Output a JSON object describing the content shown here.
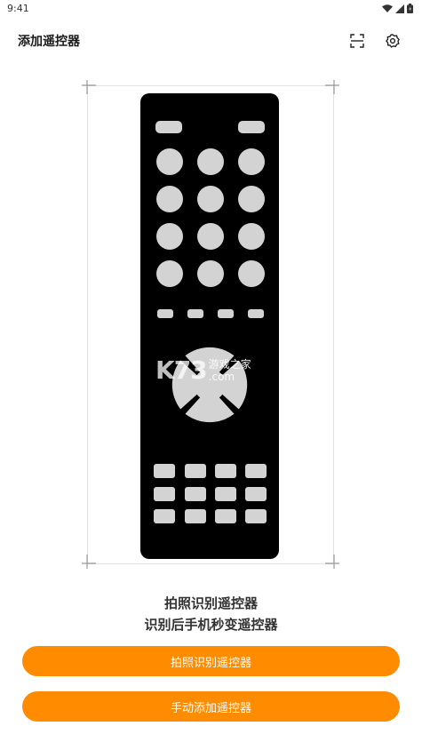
{
  "status_bar": {
    "time": "9:41",
    "icons": [
      "wifi-icon",
      "signal-icon",
      "battery-icon"
    ]
  },
  "appbar": {
    "title": "添加遥控器",
    "icons": [
      "scan-icon",
      "gear-icon"
    ]
  },
  "watermark": {
    "logo": "K73",
    "line1": "游戏之家",
    "line2": ".com"
  },
  "caption": {
    "line1": "拍照识别遥控器",
    "line2": "识别后手机秒变遥控器"
  },
  "buttons": {
    "photo_label": "拍照识别遥控器",
    "manual_label": "手动添加遥控器"
  },
  "colors": {
    "accent": "#ff8c00",
    "remote_body": "#000000",
    "remote_buttons": "#d3d3d3"
  }
}
